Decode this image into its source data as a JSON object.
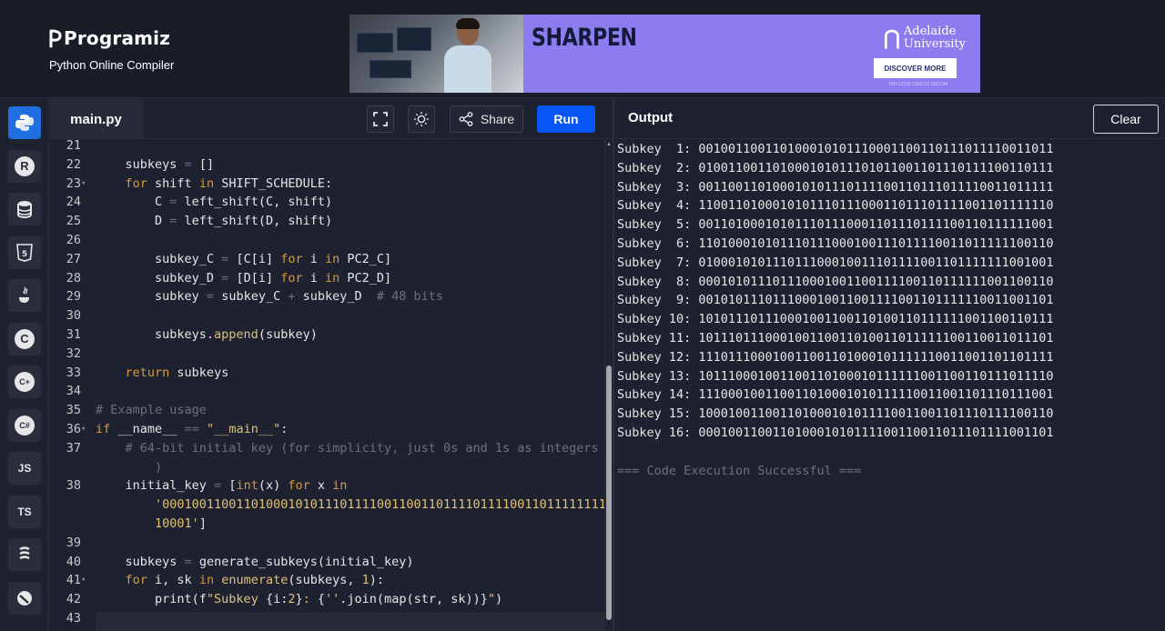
{
  "brand": {
    "name": "Programiz",
    "subtitle": "Python Online Compiler"
  },
  "ad": {
    "headline": "SHARPEN",
    "university": "Adelaide\nUniversity",
    "cta": "DISCOVER MORE",
    "fine_print": "PRV12105 CRICOS 00123M"
  },
  "sidebar": {
    "items": [
      {
        "name": "python",
        "label": "",
        "active": true
      },
      {
        "name": "r",
        "label": "R"
      },
      {
        "name": "sql",
        "label": ""
      },
      {
        "name": "html",
        "label": "5"
      },
      {
        "name": "java",
        "label": ""
      },
      {
        "name": "c",
        "label": "C"
      },
      {
        "name": "cpp",
        "label": "C"
      },
      {
        "name": "csharp",
        "label": "C"
      },
      {
        "name": "js",
        "label": "JS"
      },
      {
        "name": "ts",
        "label": "TS"
      },
      {
        "name": "go",
        "label": ""
      },
      {
        "name": "swift",
        "label": ""
      }
    ]
  },
  "editor": {
    "filename": "main.py",
    "share_label": "Share",
    "run_label": "Run",
    "lines": [
      {
        "n": "21",
        "fold": "",
        "html": ""
      },
      {
        "n": "22",
        "fold": "",
        "html": "    subkeys <span class='cm'>=</span> []"
      },
      {
        "n": "23",
        "fold": "▾",
        "html": "    <span class='kw'>for</span> shift <span class='kw'>in</span> SHIFT_SCHEDULE:"
      },
      {
        "n": "24",
        "fold": "",
        "html": "        C <span class='cm'>=</span> left_shift(C, shift)"
      },
      {
        "n": "25",
        "fold": "",
        "html": "        D <span class='cm'>=</span> left_shift(D, shift)"
      },
      {
        "n": "26",
        "fold": "",
        "html": ""
      },
      {
        "n": "27",
        "fold": "",
        "html": "        subkey_C <span class='cm'>=</span> [C[i] <span class='kw'>for</span> i <span class='kw'>in</span> PC2_C]"
      },
      {
        "n": "28",
        "fold": "",
        "html": "        subkey_D <span class='cm'>=</span> [D[i] <span class='kw'>for</span> i <span class='kw'>in</span> PC2_D]"
      },
      {
        "n": "29",
        "fold": "",
        "html": "        subkey <span class='cm'>=</span> subkey_C <span class='cm'>+</span> subkey_D  <span class='cm'># 48 bits</span>"
      },
      {
        "n": "30",
        "fold": "",
        "html": ""
      },
      {
        "n": "31",
        "fold": "",
        "html": "        subkeys.<span class='str'>append</span>(subkey)"
      },
      {
        "n": "32",
        "fold": "",
        "html": ""
      },
      {
        "n": "33",
        "fold": "",
        "html": "    <span class='kw'>return</span> subkeys"
      },
      {
        "n": "34",
        "fold": "",
        "html": ""
      },
      {
        "n": "35",
        "fold": "",
        "html": "<span class='cm'># Example usage</span>"
      },
      {
        "n": "36",
        "fold": "▾",
        "html": "<span class='kw'>if</span> __name__ <span class='cm'>==</span> <span class='str'>\"__main__\"</span>:"
      },
      {
        "n": "37",
        "fold": "",
        "html": "    <span class='cm'># 64-bit initial key (for simplicity, just 0s and 1s as integers</span>"
      },
      {
        "n": "",
        "fold": "",
        "html": "        <span class='cm'>)</span>"
      },
      {
        "n": "38",
        "fold": "",
        "html": "    initial_key <span class='cm'>=</span> [<span class='kw'>int</span>(x) <span class='kw'>for</span> x <span class='kw'>in</span>"
      },
      {
        "n": "",
        "fold": "",
        "html": "        <span class='str'>'0001001100110100010101110111100110011011110111100110111111111</span>"
      },
      {
        "n": "",
        "fold": "",
        "html": "        <span class='str'>10001'</span>]"
      },
      {
        "n": "39",
        "fold": "",
        "html": ""
      },
      {
        "n": "40",
        "fold": "",
        "html": "    subkeys <span class='cm'>=</span> generate_subkeys(initial_key)"
      },
      {
        "n": "41",
        "fold": "▾",
        "html": "    <span class='kw'>for</span> i, sk <span class='kw'>in</span> <span class='str'>enumerate</span>(subkeys, <span class='str'>1</span>):"
      },
      {
        "n": "42",
        "fold": "",
        "html": "        print(f<span class='str'>\"Subkey </span>{i:<span class='str'>2</span>}<span class='str'>: </span>{<span class='str'>''</span>.join(map(str, sk))}<span class='str'>\"</span>)"
      },
      {
        "n": "43",
        "fold": "",
        "html": ""
      }
    ]
  },
  "output": {
    "title": "Output",
    "clear_label": "Clear",
    "lines": [
      "Subkey  1: 001001100110100010101110001100110111011110011011",
      "Subkey  2: 010011001101000101011101011001101110111100110111",
      "Subkey  3: 001100110100010101110111100110111011110011011111",
      "Subkey  4: 110011010001010111011100011011101111001101111110",
      "Subkey  5: 001101000101011101110001101110111100110111111001",
      "Subkey  6: 110100010101110111000100111011110011011111100110",
      "Subkey  7: 010001010111011100010011101111001101111111001001",
      "Subkey  8: 000101011101110001001100111100110111111001100110",
      "Subkey  9: 001010111011100010011001111001101111110011001101",
      "Subkey 10: 101011101110001001100110100110111111001100110111",
      "Subkey 11: 101110111000100110011010011011111100110011011101",
      "Subkey 12: 111011100010011001101000101111110011001101101111",
      "Subkey 13: 101110001001100110100010111111001100110111011110",
      "Subkey 14: 111000100110011010001010111110011001101110111001",
      "Subkey 15: 100010011001101000101011110011001101110111100110",
      "Subkey 16: 000100110011010001010111100110011011101111001101",
      "",
      "=== Code Execution Successful ==="
    ]
  }
}
